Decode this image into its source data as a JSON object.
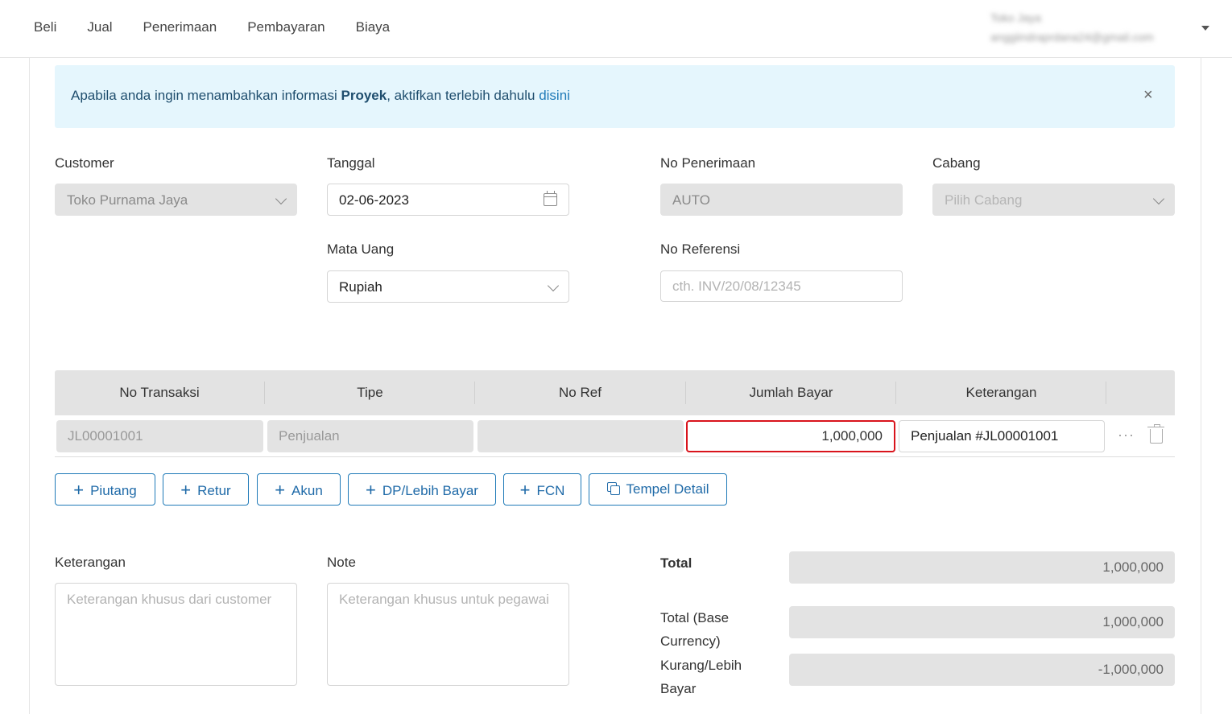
{
  "nav": {
    "items": [
      "Beli",
      "Jual",
      "Penerimaan",
      "Pembayaran",
      "Biaya"
    ],
    "user_name": "Toko Jaya",
    "user_email": "anggiindraprdana24@gmail.com"
  },
  "alert": {
    "text_before": "Apabila anda ingin menambahkan informasi ",
    "bold": "Proyek",
    "text_after": ", aktifkan terlebih dahulu ",
    "link": "disini",
    "close": "×"
  },
  "form": {
    "customer_label": "Customer",
    "customer_value": "Toko Purnama Jaya",
    "tanggal_label": "Tanggal",
    "tanggal_value": "02-06-2023",
    "no_penerimaan_label": "No Penerimaan",
    "no_penerimaan_value": "AUTO",
    "cabang_label": "Cabang",
    "cabang_placeholder": "Pilih Cabang",
    "mata_uang_label": "Mata Uang",
    "mata_uang_value": "Rupiah",
    "no_referensi_label": "No Referensi",
    "no_referensi_placeholder": "cth. INV/20/08/12345"
  },
  "table": {
    "headers": [
      "No Transaksi",
      "Tipe",
      "No Ref",
      "Jumlah Bayar",
      "Keterangan"
    ],
    "row": {
      "no_transaksi": "JL00001001",
      "tipe": "Penjualan",
      "no_ref": "",
      "jumlah_bayar": "1,000,000",
      "keterangan": "Penjualan #JL00001001"
    },
    "more": "···"
  },
  "buttons": {
    "piutang": "Piutang",
    "retur": "Retur",
    "akun": "Akun",
    "dp": "DP/Lebih Bayar",
    "fcn": "FCN",
    "tempel": "Tempel Detail"
  },
  "bottom": {
    "keterangan_label": "Keterangan",
    "keterangan_placeholder": "Keterangan khusus dari customer",
    "note_label": "Note",
    "note_placeholder": "Keterangan khusus untuk pegawai",
    "total_label": "Total",
    "total_value": "1,000,000",
    "total_base_label_1": "Total (Base",
    "total_base_label_2": "Currency)",
    "total_base_value": "1,000,000",
    "kurang_label_1": "Kurang/Lebih",
    "kurang_label_2": "Bayar",
    "kurang_value": "-1,000,000"
  },
  "colors": {
    "accent": "#1f7ab8",
    "alert_bg": "#e5f6fd",
    "highlight_border": "#d9141c",
    "disabled_bg": "#e3e3e3"
  }
}
